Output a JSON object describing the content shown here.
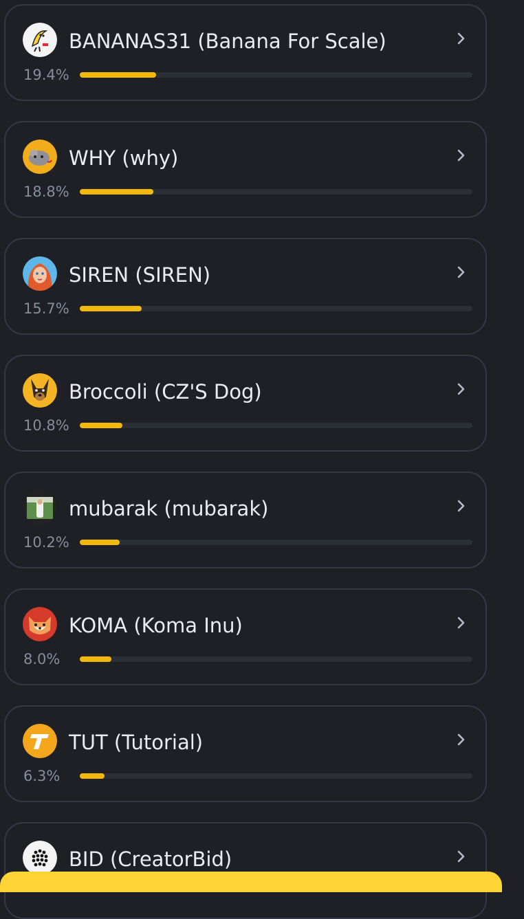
{
  "items": [
    {
      "title": "BANANAS31 (Banana For Scale)",
      "percent_label": "19.4%",
      "share": 0.194,
      "icon": "banana-token-icon"
    },
    {
      "title": "WHY (why)",
      "percent_label": "18.8%",
      "share": 0.188,
      "icon": "why-token-icon"
    },
    {
      "title": "SIREN (SIREN)",
      "percent_label": "15.7%",
      "share": 0.157,
      "icon": "siren-token-icon"
    },
    {
      "title": "Broccoli (CZ'S Dog)",
      "percent_label": "10.8%",
      "share": 0.108,
      "icon": "dog-token-icon"
    },
    {
      "title": "mubarak (mubarak)",
      "percent_label": "10.2%",
      "share": 0.102,
      "icon": "mubarak-token-icon"
    },
    {
      "title": "KOMA (Koma Inu)",
      "percent_label": "8.0%",
      "share": 0.08,
      "icon": "koma-token-icon"
    },
    {
      "title": "TUT (Tutorial)",
      "percent_label": "6.3%",
      "share": 0.063,
      "icon": "tut-token-icon"
    },
    {
      "title": "BID (CreatorBid)",
      "percent_label": "",
      "share": null,
      "icon": "bid-token-icon"
    }
  ],
  "colors": {
    "background": "#1e2026",
    "card_border": "#353944",
    "progress_fill": "#f0b90b",
    "progress_track": "#2b2f36",
    "title_text": "#eaecef",
    "percent_text": "#848e9c",
    "bottom_bar": "#fcd535"
  }
}
